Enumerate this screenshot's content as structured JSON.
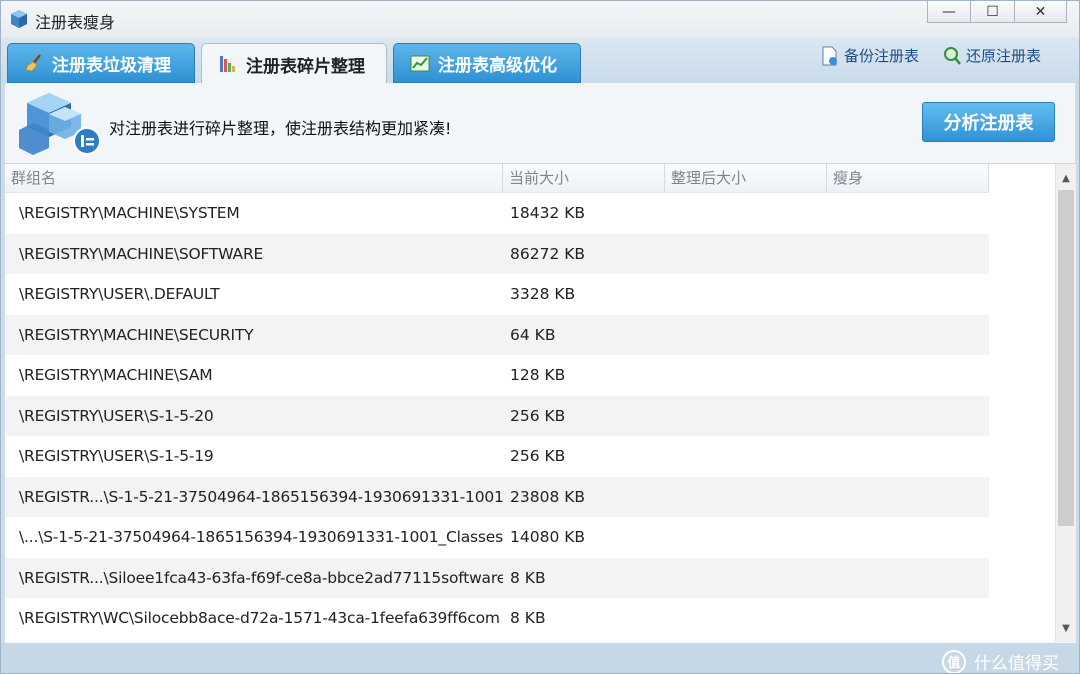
{
  "window": {
    "title": "注册表瘦身",
    "controls": {
      "minimize": "—",
      "maximize": "☐",
      "close": "✕"
    }
  },
  "tabs": [
    {
      "label": "注册表垃圾清理",
      "icon": "broom-icon",
      "active": false
    },
    {
      "label": "注册表碎片整理",
      "icon": "defrag-chart-icon",
      "active": true
    },
    {
      "label": "注册表高级优化",
      "icon": "trend-chart-icon",
      "active": false
    }
  ],
  "actions": {
    "backup_label": "备份注册表",
    "restore_label": "还原注册表"
  },
  "banner": {
    "text": "对注册表进行碎片整理，使注册表结构更加紧凑!",
    "analyze_button": "分析注册表"
  },
  "table": {
    "columns": [
      "群组名",
      "当前大小",
      "整理后大小",
      "瘦身"
    ],
    "rows": [
      {
        "name": "\\REGISTRY\\MACHINE\\SYSTEM",
        "size": "18432 KB",
        "after": "",
        "slim": ""
      },
      {
        "name": "\\REGISTRY\\MACHINE\\SOFTWARE",
        "size": "86272 KB",
        "after": "",
        "slim": ""
      },
      {
        "name": "\\REGISTRY\\USER\\.DEFAULT",
        "size": "3328 KB",
        "after": "",
        "slim": ""
      },
      {
        "name": "\\REGISTRY\\MACHINE\\SECURITY",
        "size": "64 KB",
        "after": "",
        "slim": ""
      },
      {
        "name": "\\REGISTRY\\MACHINE\\SAM",
        "size": "128 KB",
        "after": "",
        "slim": ""
      },
      {
        "name": "\\REGISTRY\\USER\\S-1-5-20",
        "size": "256 KB",
        "after": "",
        "slim": ""
      },
      {
        "name": "\\REGISTRY\\USER\\S-1-5-19",
        "size": "256 KB",
        "after": "",
        "slim": ""
      },
      {
        "name": "\\REGISTR...\\S-1-5-21-37504964-1865156394-1930691331-1001",
        "size": "23808 KB",
        "after": "",
        "slim": ""
      },
      {
        "name": "\\...\\S-1-5-21-37504964-1865156394-1930691331-1001_Classes",
        "size": "14080 KB",
        "after": "",
        "slim": ""
      },
      {
        "name": "\\REGISTR...\\Siloee1fca43-63fa-f69f-ce8a-bbce2ad77115software",
        "size": "8 KB",
        "after": "",
        "slim": ""
      },
      {
        "name": "\\REGISTRY\\WC\\Silocebb8ace-d72a-1571-43ca-1feefa639ff6com",
        "size": "8 KB",
        "after": "",
        "slim": ""
      }
    ]
  },
  "watermark": {
    "logo": "值",
    "text": "什么值得买"
  },
  "colors": {
    "tab_blue": "#2f90d2",
    "button_blue": "#3a9de0",
    "background": "#ccdcea"
  }
}
